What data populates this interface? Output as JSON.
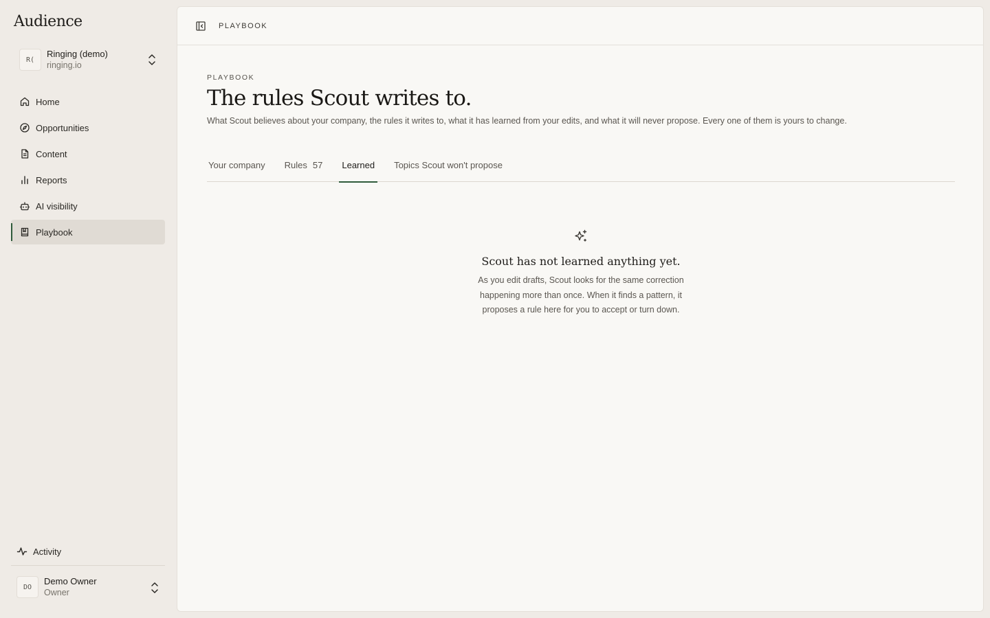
{
  "app": {
    "brand": "Audience"
  },
  "workspace": {
    "initials": "R(",
    "name": "Ringing (demo)",
    "domain": "ringing.io"
  },
  "nav": {
    "items": [
      {
        "label": "Home",
        "icon": "home-icon"
      },
      {
        "label": "Opportunities",
        "icon": "compass-icon"
      },
      {
        "label": "Content",
        "icon": "document-icon"
      },
      {
        "label": "Reports",
        "icon": "bar-chart-icon"
      },
      {
        "label": "AI visibility",
        "icon": "robot-icon"
      },
      {
        "label": "Playbook",
        "icon": "book-icon",
        "active": true
      }
    ],
    "activity": "Activity"
  },
  "user": {
    "initials": "DO",
    "name": "Demo Owner",
    "role": "Owner"
  },
  "topbar": {
    "title": "PLAYBOOK"
  },
  "page": {
    "eyebrow": "PLAYBOOK",
    "title": "The rules Scout writes to.",
    "subtitle": "What Scout believes about your company, the rules it writes to, what it has learned from your edits, and what it will never propose. Every one of them is yours to change."
  },
  "tabs": [
    {
      "label": "Your company"
    },
    {
      "label": "Rules",
      "count": "57"
    },
    {
      "label": "Learned",
      "active": true
    },
    {
      "label": "Topics Scout won't propose"
    }
  ],
  "empty": {
    "icon": "sparkles-icon",
    "title": "Scout has not learned anything yet.",
    "text": "As you edit drafts, Scout looks for the same correction happening more than once. When it finds a pattern, it proposes a rule here for you to accept or turn down."
  },
  "colors": {
    "accent": "#2e5a3a",
    "sidebar_bg": "#efebe6",
    "panel_bg": "#f9f8f5"
  }
}
